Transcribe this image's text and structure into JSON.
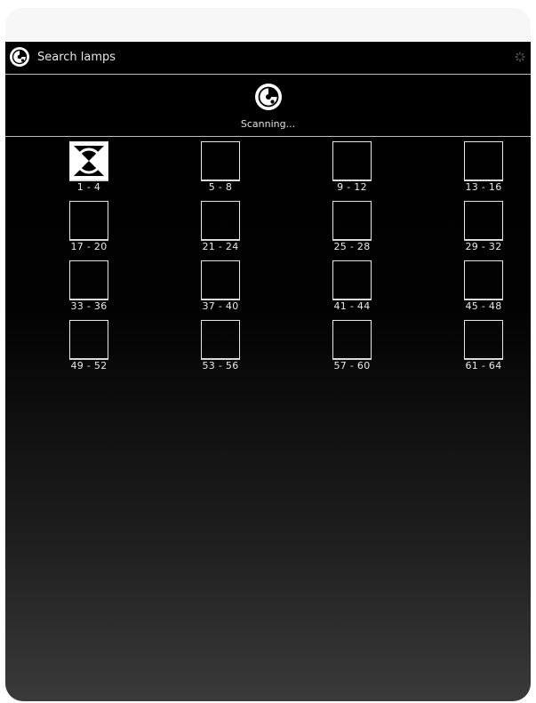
{
  "header": {
    "title": "Search lamps",
    "logo_icon": "radar-logo-icon",
    "busy_icon": "spinner-icon"
  },
  "scan": {
    "status": "Scanning...",
    "icon": "radar-scan-icon"
  },
  "lamp_groups": [
    {
      "label": "1 - 4",
      "found": true
    },
    {
      "label": "5 - 8",
      "found": false
    },
    {
      "label": "9 - 12",
      "found": false
    },
    {
      "label": "13 - 16",
      "found": false
    },
    {
      "label": "17 - 20",
      "found": false
    },
    {
      "label": "21 - 24",
      "found": false
    },
    {
      "label": "25 - 28",
      "found": false
    },
    {
      "label": "29 - 32",
      "found": false
    },
    {
      "label": "33 - 36",
      "found": false
    },
    {
      "label": "37 - 40",
      "found": false
    },
    {
      "label": "41 - 44",
      "found": false
    },
    {
      "label": "45 - 48",
      "found": false
    },
    {
      "label": "49 - 52",
      "found": false
    },
    {
      "label": "53 - 56",
      "found": false
    },
    {
      "label": "57 - 60",
      "found": false
    },
    {
      "label": "61 - 64",
      "found": false
    }
  ],
  "colors": {
    "background": "#000000",
    "text": "#e8e8e8",
    "divider": "#bdbdbd"
  }
}
